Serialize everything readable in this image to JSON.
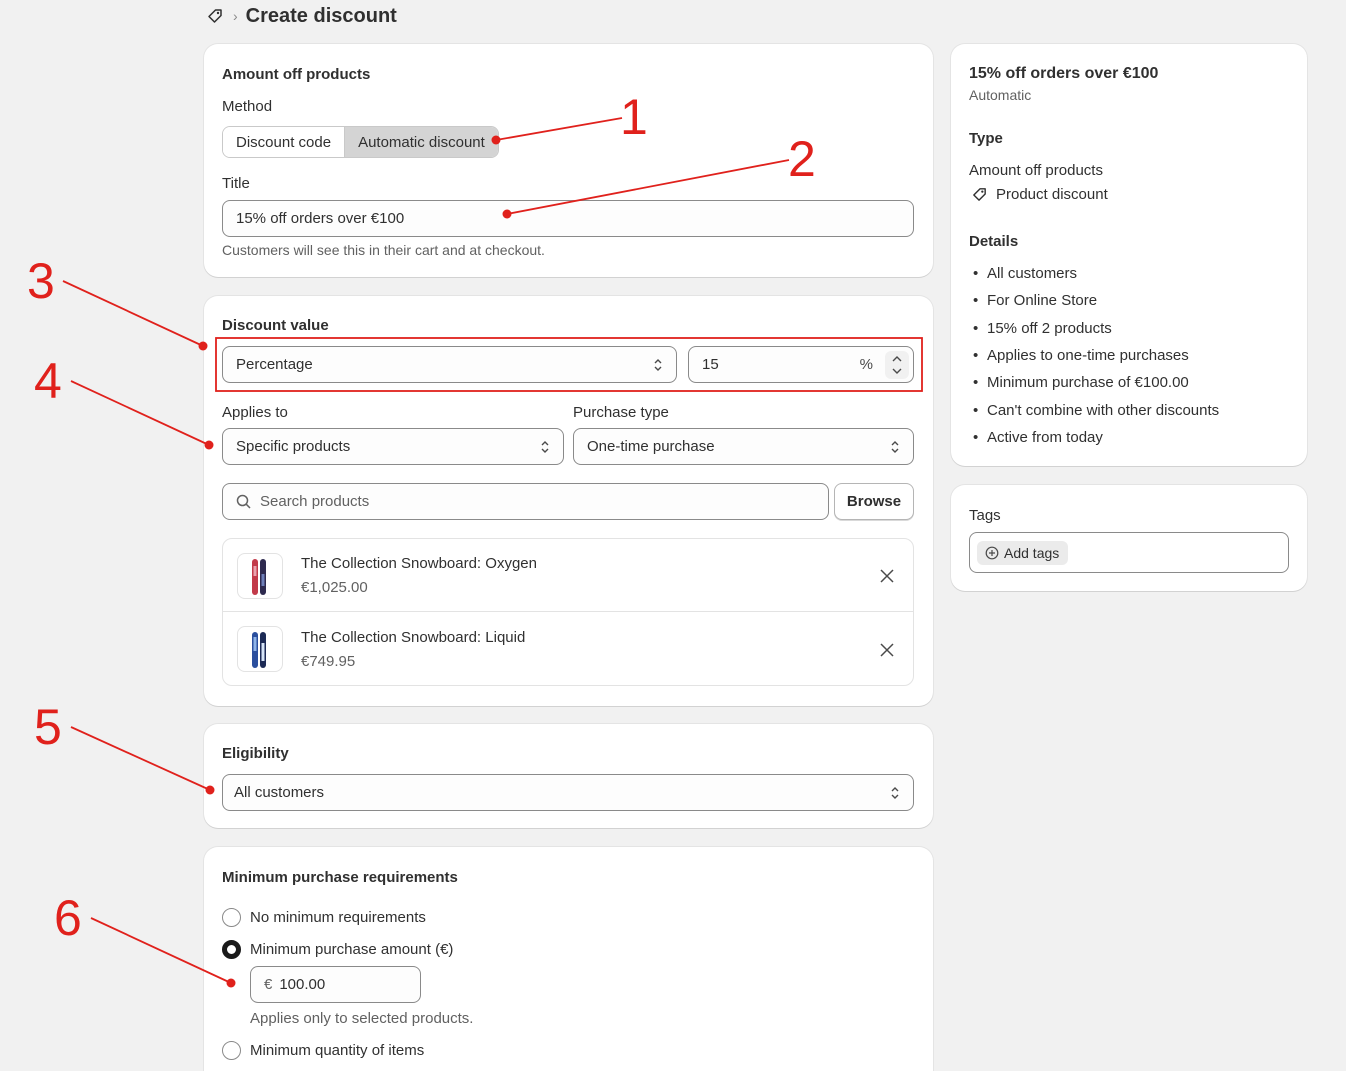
{
  "header": {
    "title": "Create discount"
  },
  "card_amount": {
    "heading": "Amount off products",
    "method_label": "Method",
    "method_options": [
      "Discount code",
      "Automatic discount"
    ],
    "title_label": "Title",
    "title_value": "15% off orders over €100",
    "title_help": "Customers will see this in their cart and at checkout."
  },
  "card_value": {
    "heading": "Discount value",
    "type_value": "Percentage",
    "amount_value": "15",
    "amount_suffix": "%",
    "applies_label": "Applies to",
    "applies_value": "Specific products",
    "purchase_label": "Purchase type",
    "purchase_value": "One-time purchase",
    "search_placeholder": "Search products",
    "browse_label": "Browse",
    "products": [
      {
        "name": "The Collection Snowboard: Oxygen",
        "price": "€1,025.00"
      },
      {
        "name": "The Collection Snowboard: Liquid",
        "price": "€749.95"
      }
    ]
  },
  "card_elig": {
    "heading": "Eligibility",
    "value": "All customers"
  },
  "card_min": {
    "heading": "Minimum purchase requirements",
    "opt_none": "No minimum requirements",
    "opt_amount": "Minimum purchase amount (€)",
    "currency": "€",
    "amount": "100.00",
    "help": "Applies only to selected products.",
    "opt_qty": "Minimum quantity of items"
  },
  "summary": {
    "title": "15% off orders over €100",
    "subtitle": "Automatic",
    "type_heading": "Type",
    "type_value": "Amount off products",
    "type_sub": "Product discount",
    "details_heading": "Details",
    "details": [
      "All customers",
      "For Online Store",
      "15% off 2 products",
      "Applies to one-time purchases",
      "Minimum purchase of €100.00",
      "Can't combine with other discounts",
      "Active from today"
    ]
  },
  "tags": {
    "heading": "Tags",
    "add_label": "Add tags"
  },
  "annotations": [
    "1",
    "2",
    "3",
    "4",
    "5",
    "6"
  ],
  "colors": {
    "annotation": "#e0211c",
    "background": "#f1f1f1",
    "card": "#ffffff"
  }
}
